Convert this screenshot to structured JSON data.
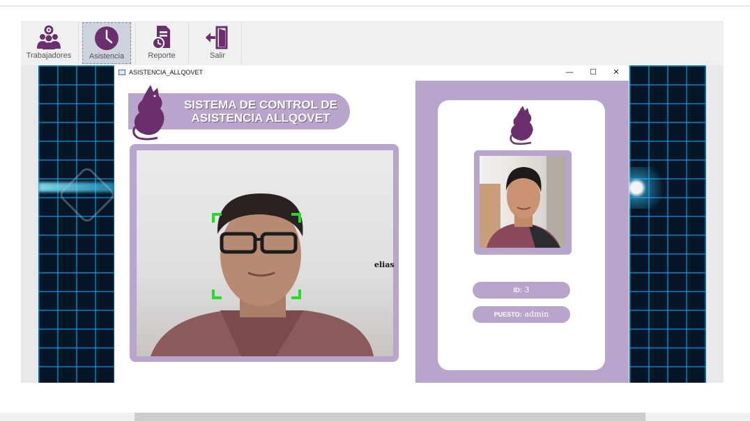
{
  "toolbar": {
    "items": [
      {
        "label": "Trabajadores",
        "icon": "users-gear-icon"
      },
      {
        "label": "Asistencia",
        "icon": "clock-icon",
        "active": true
      },
      {
        "label": "Reporte",
        "icon": "report-icon"
      },
      {
        "label": "Salir",
        "icon": "exit-door-icon"
      }
    ]
  },
  "window": {
    "title": "ASISTENCIA_ALLQOVET",
    "controls": {
      "minimize": "—",
      "maximize": "☐",
      "close": "✕"
    }
  },
  "app": {
    "banner_line1": "SISTEMA DE CONTROL DE",
    "banner_line2": "ASISTENCIA ALLQOVET",
    "detected_name": "elias",
    "id_label": "ID:",
    "id_value": "3",
    "puesto_label": "PUESTO:",
    "puesto_value": "admin"
  },
  "colors": {
    "accent": "#b9a5cc",
    "logo": "#6b2f6e",
    "detection_box": "#22dd22"
  }
}
